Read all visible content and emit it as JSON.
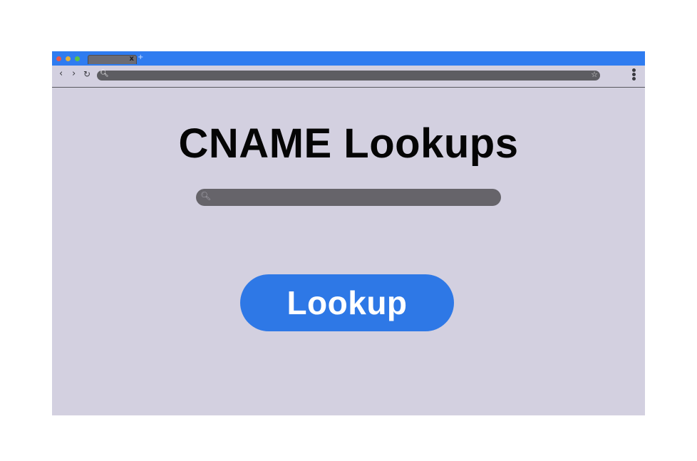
{
  "browser": {
    "tab": {
      "close_glyph": "x",
      "new_tab_glyph": "+"
    },
    "nav": {
      "back_glyph": "‹",
      "forward_glyph": "›",
      "reload_glyph": "↻"
    },
    "address_bar": {
      "value": "",
      "search_icon": "search-icon",
      "bookmark_icon": "star-icon"
    },
    "menu_icon": "kebab-menu-icon"
  },
  "page": {
    "title": "CNAME Lookups",
    "search": {
      "value": "",
      "placeholder": "",
      "icon": "search-icon"
    },
    "lookup_button_label": "Lookup"
  },
  "colors": {
    "titlebar": "#2f7cf0",
    "page_background": "#d3d0e0",
    "search_bar": "#66646a",
    "button": "#2e78e6"
  }
}
